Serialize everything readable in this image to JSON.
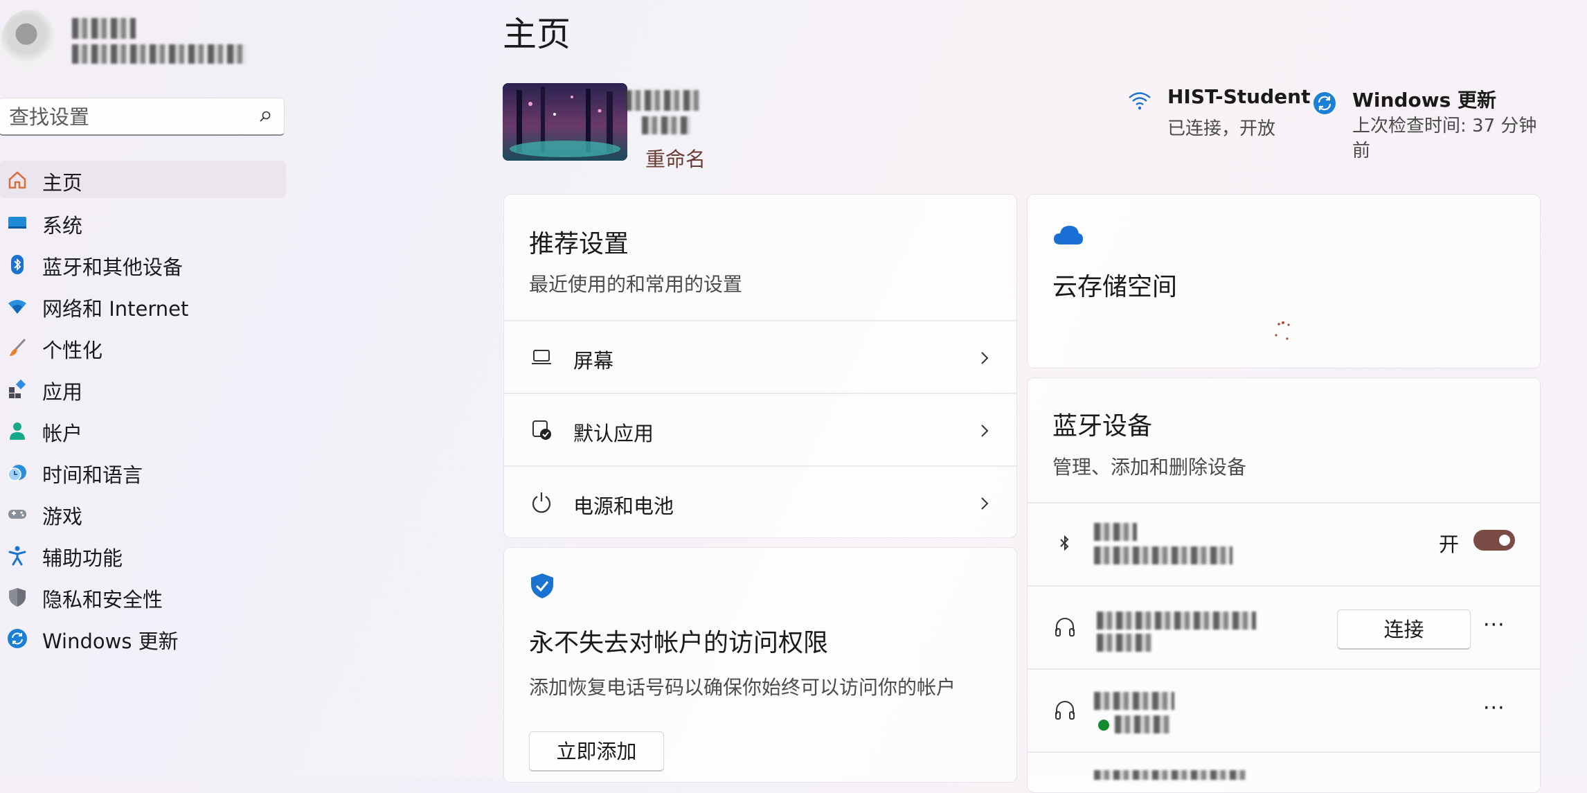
{
  "sidebar": {
    "search_placeholder": "查找设置",
    "items": [
      {
        "label": "主页",
        "icon": "home-icon",
        "active": true
      },
      {
        "label": "系统",
        "icon": "system-icon"
      },
      {
        "label": "蓝牙和其他设备",
        "icon": "bluetooth-icon"
      },
      {
        "label": "网络和 Internet",
        "icon": "network-icon"
      },
      {
        "label": "个性化",
        "icon": "brush-icon"
      },
      {
        "label": "应用",
        "icon": "apps-icon"
      },
      {
        "label": "帐户",
        "icon": "account-icon"
      },
      {
        "label": "时间和语言",
        "icon": "time-language-icon"
      },
      {
        "label": "游戏",
        "icon": "gamepad-icon"
      },
      {
        "label": "辅助功能",
        "icon": "accessibility-icon"
      },
      {
        "label": "隐私和安全性",
        "icon": "shield-icon"
      },
      {
        "label": "Windows 更新",
        "icon": "update-icon"
      }
    ]
  },
  "header": {
    "title": "主页",
    "rename": "重命名",
    "wifi": {
      "name": "HIST-Student",
      "status": "已连接，开放"
    },
    "update": {
      "title": "Windows 更新",
      "status": "上次检查时间: 37 分钟前"
    }
  },
  "recommended": {
    "title": "推荐设置",
    "subtitle": "最近使用的和常用的设置",
    "rows": [
      {
        "label": "屏幕",
        "icon": "laptop-icon"
      },
      {
        "label": "默认应用",
        "icon": "default-apps-icon"
      },
      {
        "label": "电源和电池",
        "icon": "power-icon"
      }
    ]
  },
  "account_card": {
    "title": "永不失去对帐户的访问权限",
    "subtitle": "添加恢复电话号码以确保你始终可以访问你的帐户",
    "button": "立即添加"
  },
  "cloud": {
    "title": "云存储空间"
  },
  "bluetooth": {
    "title": "蓝牙设备",
    "subtitle": "管理、添加和删除设备",
    "toggle_label": "开",
    "toggle_on": true,
    "connect_button": "连接",
    "more": "···"
  },
  "colors": {
    "accent": "#0067c0",
    "toggle": "#7a4b45",
    "link": "#6a3c34"
  }
}
